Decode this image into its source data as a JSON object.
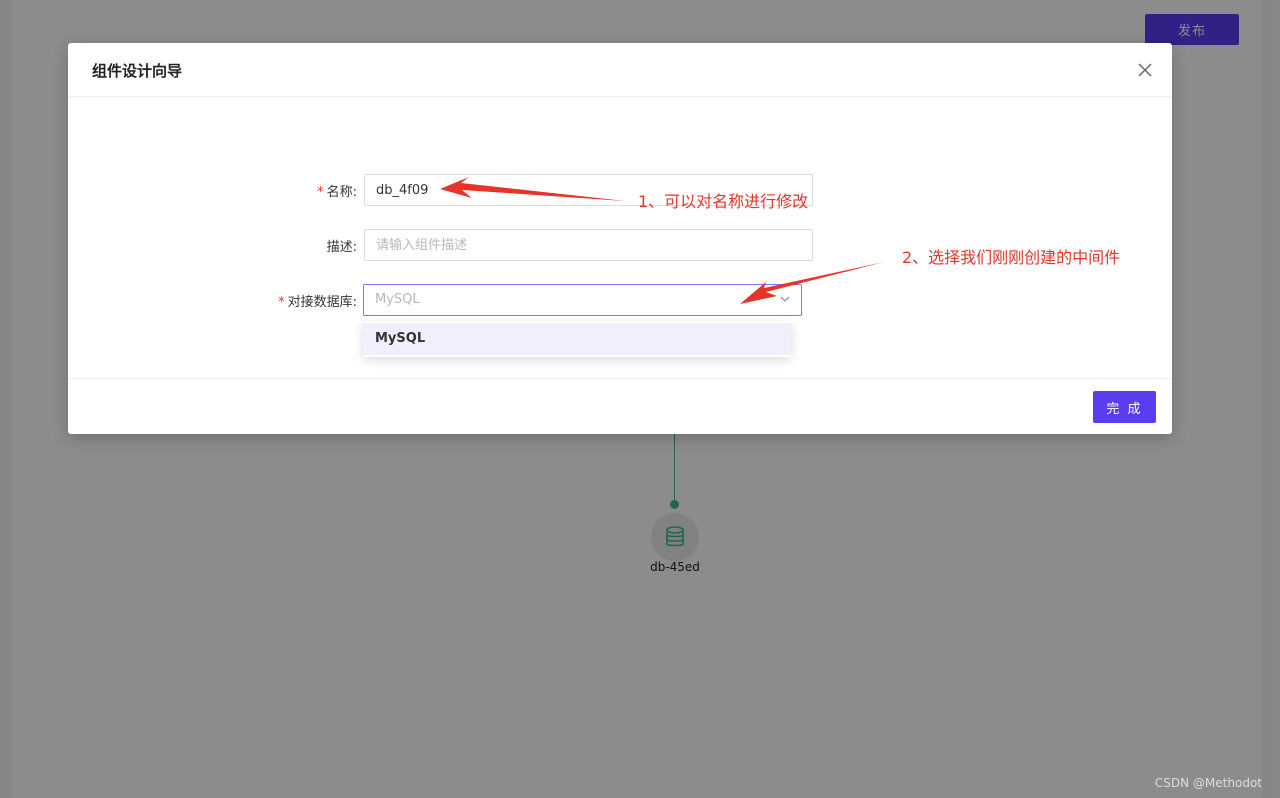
{
  "toolbar": {
    "publish_label": "发布"
  },
  "canvas": {
    "node_label": "db-45ed"
  },
  "modal": {
    "title": "组件设计向导",
    "fields": {
      "name": {
        "label": "名称:",
        "required": "*",
        "value": "db_4f09"
      },
      "description": {
        "label": "描述:",
        "placeholder": "请输入组件描述"
      },
      "database": {
        "label": "对接数据库:",
        "required": "*",
        "selected": "MySQL"
      }
    },
    "dropdown": {
      "options": [
        "MySQL"
      ]
    },
    "finish_label": "完 成"
  },
  "annotations": {
    "note1": "1、可以对名称进行修改",
    "note2": "2、选择我们刚刚创建的中间件"
  },
  "watermark": "CSDN @Methodot",
  "colors": {
    "accent": "#5b3df0",
    "annotation": "#e5352b",
    "flow": "#3fb59a"
  },
  "icons": {
    "close": "close-icon",
    "node": "database-icon",
    "select": "chevron-down-icon"
  }
}
